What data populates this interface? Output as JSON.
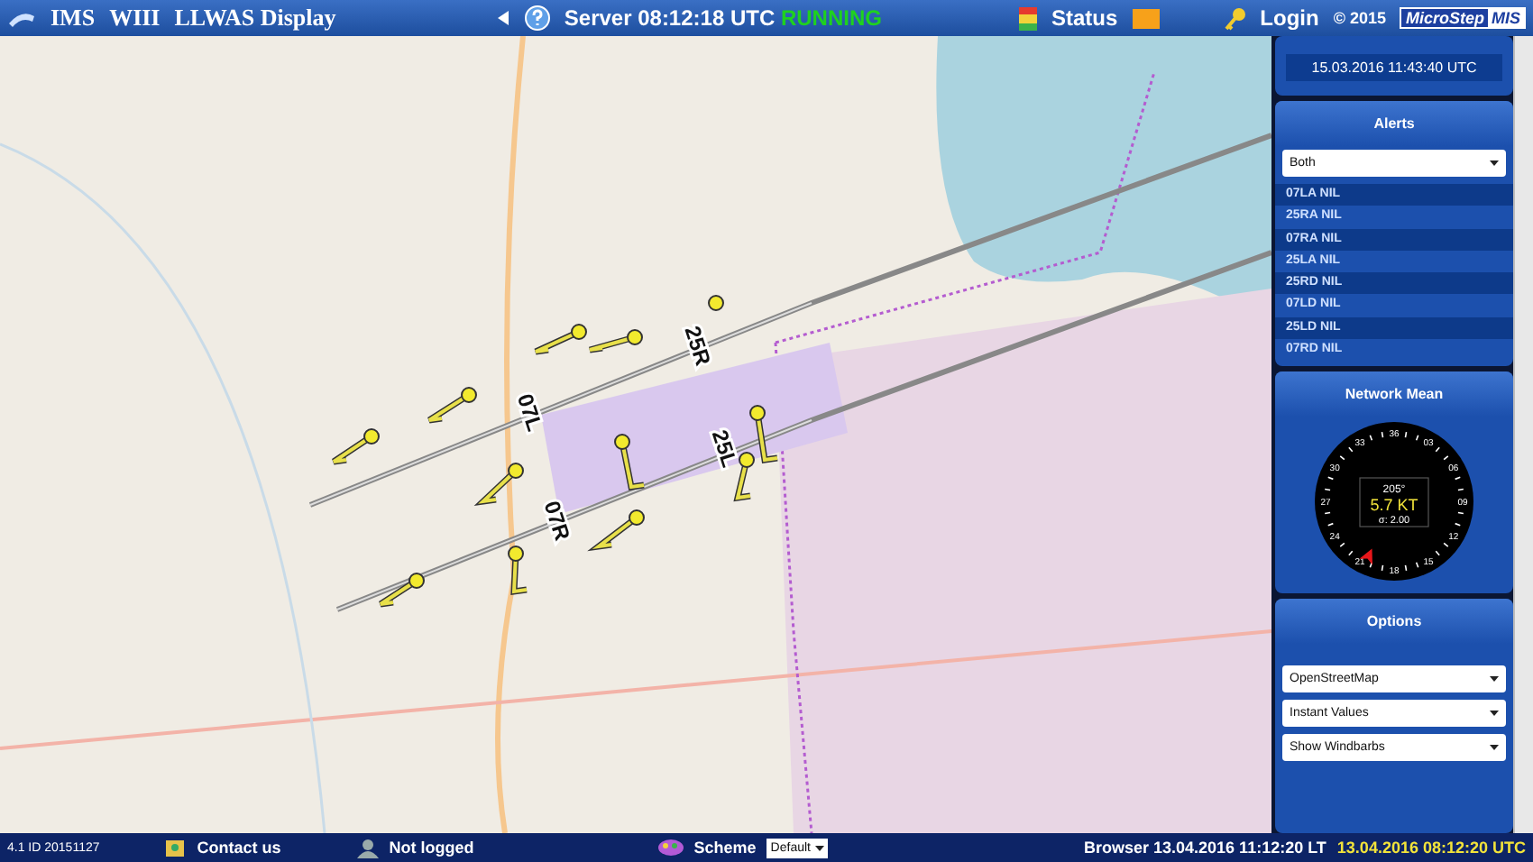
{
  "header": {
    "app": "IMS",
    "station": "WIII",
    "title": "LLWAS Display",
    "server_time": "Server 08:12:18 UTC",
    "server_state": "RUNNING",
    "status": "Status",
    "login": "Login",
    "copyright": "© 2015",
    "brand_a": "MicroStep",
    "brand_b": "MIS"
  },
  "map": {
    "runway_labels": [
      "25R",
      "07L",
      "25L",
      "07R"
    ]
  },
  "last_windshear": {
    "time": "15.03.2016 11:43:40 UTC"
  },
  "alerts": {
    "title": "Alerts",
    "filter": "Both",
    "items": [
      "07LA NIL",
      "25RA NIL",
      "07RA NIL",
      "25LA NIL",
      "25RD NIL",
      "07LD NIL",
      "25LD NIL",
      "07RD NIL"
    ]
  },
  "network_mean": {
    "title": "Network Mean",
    "dial_labels": [
      "36",
      "03",
      "06",
      "09",
      "12",
      "15",
      "18",
      "21",
      "24",
      "27",
      "30",
      "33"
    ],
    "direction": "205°",
    "speed": "5.7 KT",
    "sigma": "σ: 2.00"
  },
  "options": {
    "title": "Options",
    "selects": [
      "OpenStreetMap",
      "Instant Values",
      "Show Windbarbs"
    ]
  },
  "footer": {
    "version": "4.1 ID 20151127",
    "contact": "Contact us",
    "user": "Not logged",
    "scheme": "Scheme",
    "scheme_value": "Default",
    "browser_time": "Browser 13.04.2016 11:12:20 LT",
    "utc_time": "13.04.2016 08:12:20 UTC"
  }
}
